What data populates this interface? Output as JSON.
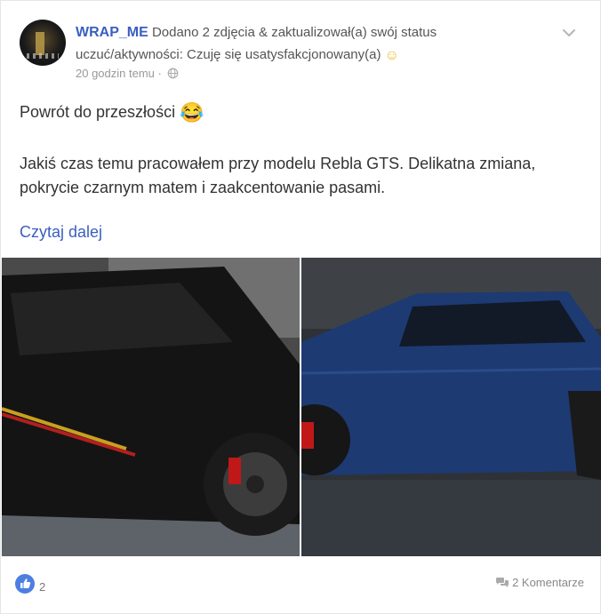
{
  "post": {
    "author": "WRAP_ME",
    "action_line": " Dodano 2 zdjęcia & zaktualizował(a) swój status",
    "status_line": "uczuć/aktywności: Czuję się usatysfakcjonowany(a) ",
    "status_emoji": "☺",
    "time": "20 godzin temu",
    "separator": " · ",
    "title": "Powrót do przeszłości ",
    "title_emoji": "😂",
    "text": "Jakiś czas temu pracowałem przy modelu Rebla GTS. Delikatna zmiana, pokrycie czarnym matem i zaakcentowanie pasami.",
    "read_more": "Czytaj dalej"
  },
  "footer": {
    "likes": "2",
    "comments_label": "2 Komentarze"
  },
  "icons": {
    "menu": "chevron-down-icon",
    "privacy": "globe-icon",
    "like": "thumbs-up-icon",
    "comment": "comment-bubbles-icon"
  },
  "colors": {
    "accent": "#3b5fc0",
    "like_badge": "#4d7fe0"
  }
}
